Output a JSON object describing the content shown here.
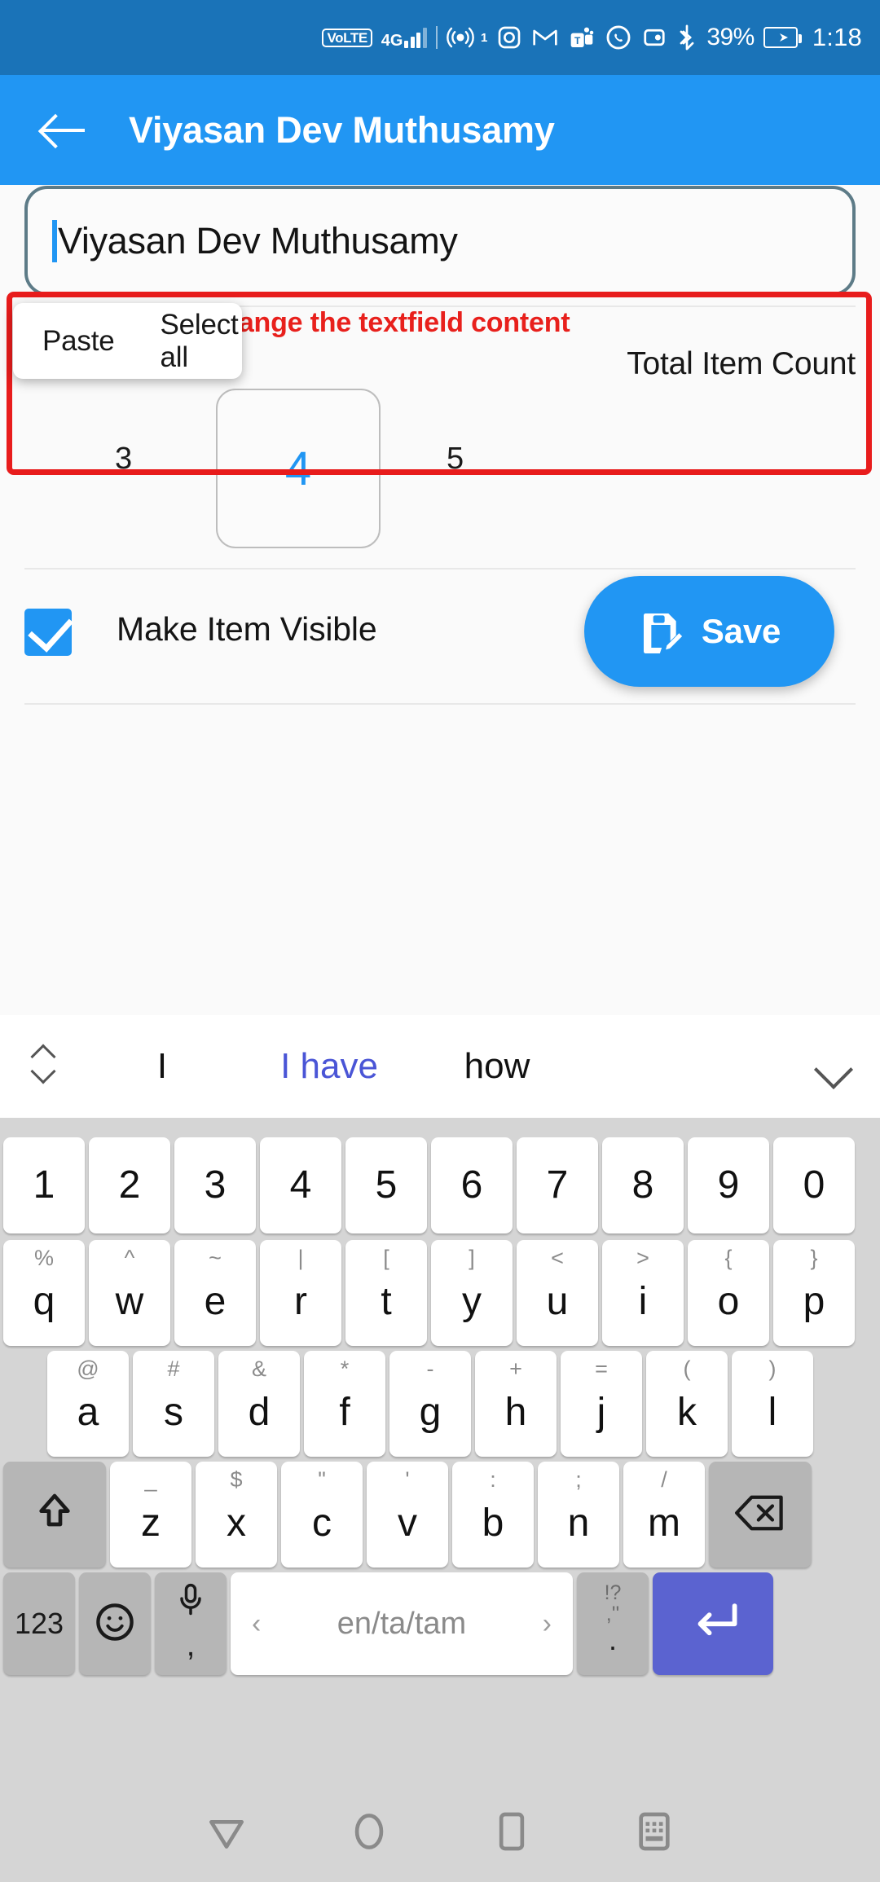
{
  "status_bar": {
    "volte": "VoLTE",
    "network": "4G",
    "hotspot_badge": "1",
    "battery_percent": "39%",
    "time": "1:18",
    "icons": [
      "volte-icon",
      "signal-bars-icon",
      "hotspot-icon",
      "instagram-icon",
      "gmail-icon",
      "teams-icon",
      "whatsapp-icon",
      "wallet-icon",
      "bluetooth-icon",
      "battery-charging-icon"
    ]
  },
  "app_bar": {
    "back_label": "back-arrow",
    "title": "Viyasan Dev Muthusamy"
  },
  "context_menu": {
    "paste": "Paste",
    "select_all": "Select all"
  },
  "form": {
    "textfield_value": "Viyasan Dev Muthusamy",
    "error_text": "User cannot change the textfield content",
    "count_label": "Total Item Count",
    "count_prev": "3",
    "count_selected": "4",
    "count_next": "5",
    "checkbox_label": "Make Item Visible",
    "checkbox_checked": true,
    "save_label": "Save"
  },
  "colors": {
    "status_bar": "#1a73b8",
    "app_bar": "#2196f3",
    "accent": "#2196f3",
    "error": "#e8201c",
    "annotation": "#e81c1c",
    "keyboard_bg": "#d5d5d5",
    "enter_key": "#5b63d0",
    "suggestion_highlight": "#4a55d6"
  },
  "keyboard": {
    "suggestions": [
      "I",
      "I have",
      "how"
    ],
    "row_numbers": [
      "1",
      "2",
      "3",
      "4",
      "5",
      "6",
      "7",
      "8",
      "9",
      "0"
    ],
    "row_q": [
      {
        "main": "q",
        "sub": "%"
      },
      {
        "main": "w",
        "sub": "^"
      },
      {
        "main": "e",
        "sub": "~"
      },
      {
        "main": "r",
        "sub": "|"
      },
      {
        "main": "t",
        "sub": "["
      },
      {
        "main": "y",
        "sub": "]"
      },
      {
        "main": "u",
        "sub": "<"
      },
      {
        "main": "i",
        "sub": ">"
      },
      {
        "main": "o",
        "sub": "{"
      },
      {
        "main": "p",
        "sub": "}"
      }
    ],
    "row_a": [
      {
        "main": "a",
        "sub": "@"
      },
      {
        "main": "s",
        "sub": "#"
      },
      {
        "main": "d",
        "sub": "&"
      },
      {
        "main": "f",
        "sub": "*"
      },
      {
        "main": "g",
        "sub": "-"
      },
      {
        "main": "h",
        "sub": "+"
      },
      {
        "main": "j",
        "sub": "="
      },
      {
        "main": "k",
        "sub": "("
      },
      {
        "main": "l",
        "sub": ")"
      }
    ],
    "row_z": [
      {
        "main": "z",
        "sub": "_"
      },
      {
        "main": "x",
        "sub": "$"
      },
      {
        "main": "c",
        "sub": "\""
      },
      {
        "main": "v",
        "sub": "'"
      },
      {
        "main": "b",
        "sub": ":"
      },
      {
        "main": "n",
        "sub": ";"
      },
      {
        "main": "m",
        "sub": "/"
      }
    ],
    "shift_key": "shift-icon",
    "backspace_key": "backspace-icon",
    "num_key": "123",
    "emoji_key": "emoji-icon",
    "mic_key": "mic-icon",
    "comma_key": ",",
    "space_label": "en/ta/tam",
    "space_prev": "‹",
    "space_next": "›",
    "period_sub": "!?",
    "period_sub2": ",''",
    "period_main": ".",
    "enter_key": "enter-icon"
  },
  "nav_bar": {
    "back": "nav-back-icon",
    "home": "nav-home-icon",
    "recents": "nav-recents-icon",
    "keyboard_toggle": "nav-keyboard-icon"
  }
}
